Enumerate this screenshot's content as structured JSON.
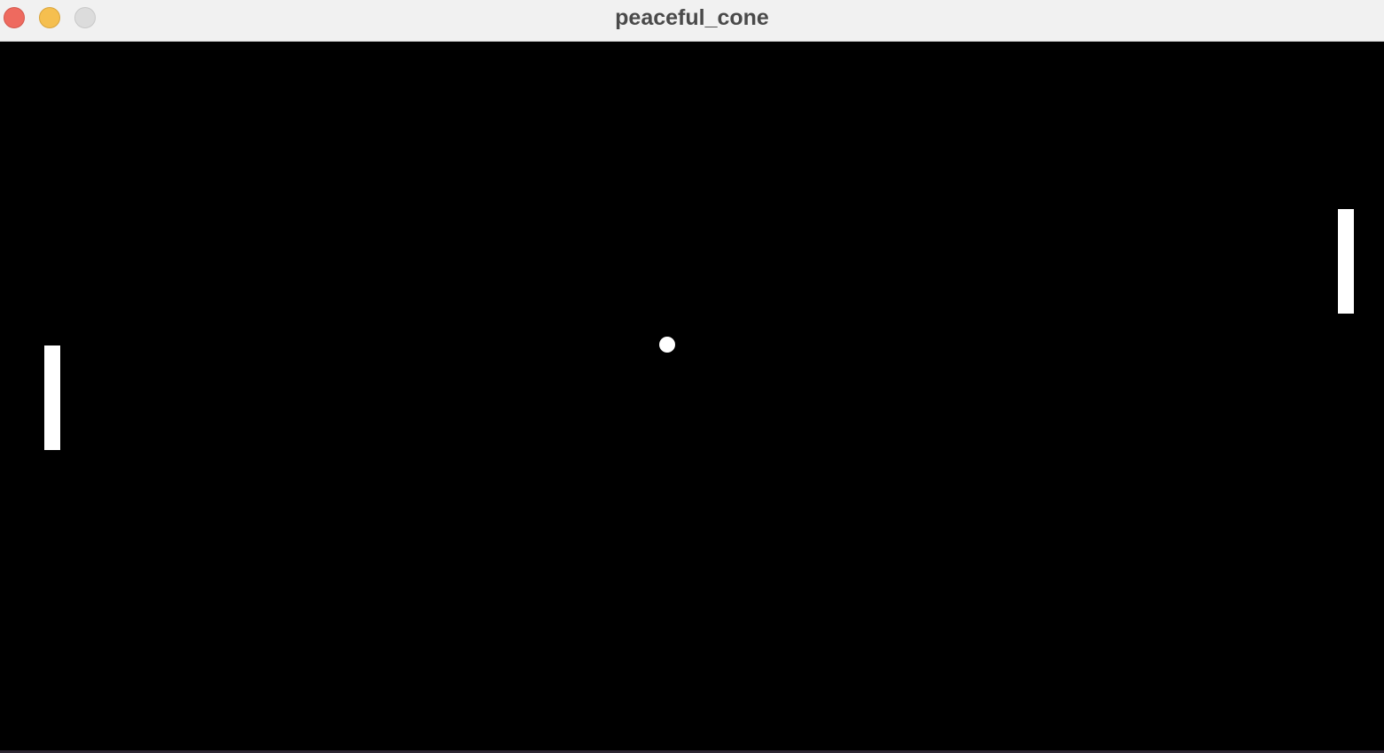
{
  "window": {
    "title": "peaceful_cone"
  },
  "controls": {
    "close": "close-icon",
    "minimize": "minimize-icon",
    "zoom": "zoom-icon"
  },
  "colors": {
    "background": "#000000",
    "paddle": "#ffffff",
    "ball": "#ffffff",
    "titlebar": "#f1f1f1",
    "close": "#ee6a5f",
    "minimize": "#f5bf4f",
    "zoom": "#dcdcdc"
  }
}
